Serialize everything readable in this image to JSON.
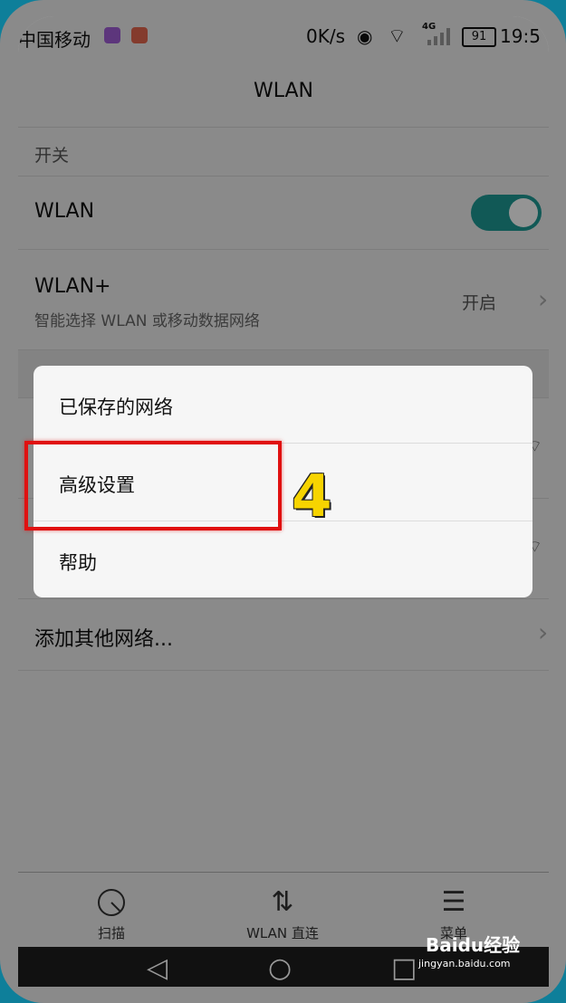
{
  "status_bar": {
    "carrier": "中国移动",
    "net_speed": "0K/s",
    "network_type": "4G",
    "battery": "91",
    "time": "19:5"
  },
  "header": {
    "title": "WLAN"
  },
  "section": {
    "label": "开关"
  },
  "wlan_row": {
    "label": "WLAN",
    "enabled": true
  },
  "wlan_plus_row": {
    "label": "WLAN+",
    "subtitle": "智能选择 WLAN 或移动数据网络",
    "value": "开启"
  },
  "add_network_row": {
    "label": "添加其他网络..."
  },
  "popup_menu": {
    "items": [
      {
        "label": "已保存的网络"
      },
      {
        "label": "高级设置"
      },
      {
        "label": "帮助"
      }
    ]
  },
  "annotation": {
    "step": "4"
  },
  "bottom_nav": {
    "scan": "扫描",
    "direct": "WLAN 直连",
    "menu": "菜单"
  },
  "watermark": {
    "logo": "Baidu经验",
    "url": "jingyan.baidu.com"
  },
  "colors": {
    "toggle_on": "#1e9a95",
    "highlight": "#e01010",
    "step": "#f7d400"
  }
}
